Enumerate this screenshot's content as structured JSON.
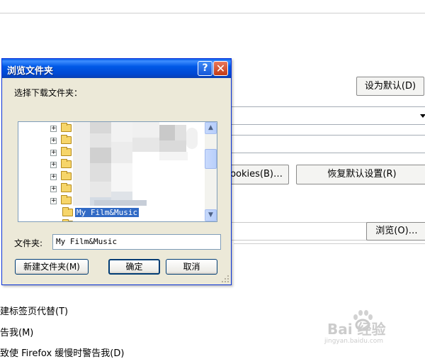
{
  "background": {
    "set_default_label": "设为默认(D)",
    "cookies_label": "Cookies(B)…",
    "restore_default_label": "恢复默认设置(R)",
    "browse_label": "浏览(O)…",
    "option1": "建标签页代替(T)",
    "option2": "告我(M)",
    "option3": "致使 Firefox 缓慢时警告我(D)"
  },
  "dialog": {
    "title": "浏览文件夹",
    "help_glyph": "?",
    "close_glyph": "✕",
    "prompt": "选择下载文件夹：",
    "tree": {
      "selected_item": "My Film&Music"
    },
    "folder_label": "文件夹:",
    "folder_value": "My Film&Music",
    "new_folder_label": "新建文件夹(M)",
    "ok_label": "确定",
    "cancel_label": "取消"
  },
  "watermark": {
    "brand": "Bai 经验",
    "url": "jingyan.baidu.com"
  },
  "colors": {
    "titlebar": "#0054e3",
    "selection": "#316ac5",
    "dialog_face": "#ece9d8"
  }
}
